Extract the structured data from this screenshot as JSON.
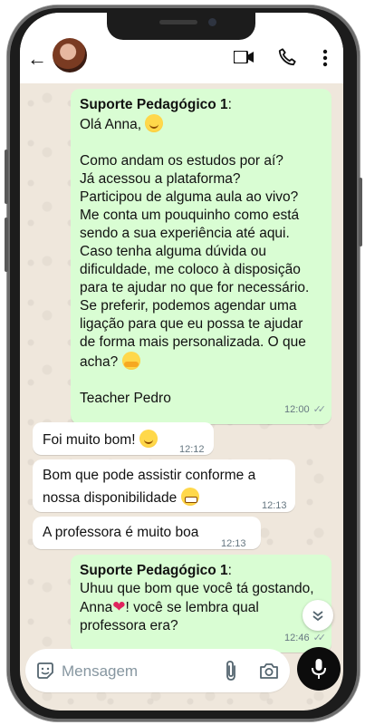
{
  "header": {
    "back_icon": "arrow-left-icon",
    "icons": [
      "video-call-icon",
      "phone-icon",
      "more-vert-icon"
    ]
  },
  "messages": [
    {
      "direction": "out",
      "sender": "Suporte Pedagógico 1",
      "lines": [
        "Olá Anna,",
        "",
        "Como andam os estudos por aí?",
        "Já acessou a plataforma?",
        "Participou de alguma aula ao vivo?",
        "Me conta um pouquinho como está",
        "sendo a sua experiência até aqui.",
        "Caso tenha alguma dúvida ou",
        "dificuldade, me coloco à disposição",
        "para te ajudar no que for necessário.",
        "Se preferir, podemos agendar uma",
        "ligação para que eu possa te ajudar",
        "de forma mais personalizada. O que",
        "acha?",
        "",
        "Teacher Pedro"
      ],
      "time": "12:00"
    },
    {
      "direction": "in",
      "text": "Foi muito bom!",
      "time": "12:12"
    },
    {
      "direction": "in",
      "lines": [
        "Bom que pode assistir conforme a",
        "nossa disponibilidade"
      ],
      "time": "12:13"
    },
    {
      "direction": "in",
      "text": "A professora é muito boa",
      "time": "12:13"
    },
    {
      "direction": "out",
      "sender": "Suporte Pedagógico 1",
      "lines": [
        "Uhuu que bom que você tá gostando,",
        "Anna",
        "! você se lembra qual",
        "professora era?"
      ],
      "time": "12:46"
    }
  ],
  "composer": {
    "placeholder": "Mensagem",
    "icons": [
      "sticker-icon",
      "attach-icon",
      "camera-icon",
      "mic-icon"
    ]
  }
}
